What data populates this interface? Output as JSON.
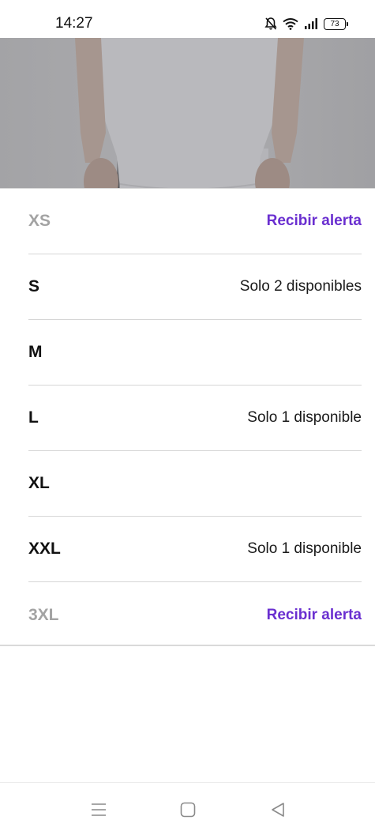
{
  "status_bar": {
    "time": "14:27",
    "battery_level": "73",
    "icons": [
      "bell-off-icon",
      "wifi-icon",
      "signal-icon",
      "battery-icon"
    ]
  },
  "hero": {
    "image": "product-photo-white-tshirt"
  },
  "colors": {
    "accent": "#6a2fd0",
    "disabled_text": "#a3a3a3",
    "divider": "#d6d6d6"
  },
  "sizes": [
    {
      "label": "XS",
      "available": false,
      "note": "",
      "action": "Recibir alerta"
    },
    {
      "label": "S",
      "available": true,
      "note": "Solo 2 disponibles",
      "action": ""
    },
    {
      "label": "M",
      "available": true,
      "note": "",
      "action": ""
    },
    {
      "label": "L",
      "available": true,
      "note": "Solo 1 disponible",
      "action": ""
    },
    {
      "label": "XL",
      "available": true,
      "note": "",
      "action": ""
    },
    {
      "label": "XXL",
      "available": true,
      "note": "Solo 1 disponible",
      "action": ""
    },
    {
      "label": "3XL",
      "available": false,
      "note": "",
      "action": "Recibir alerta"
    }
  ],
  "nav_bar": {
    "buttons": [
      "menu-icon",
      "home-icon",
      "back-icon"
    ]
  }
}
